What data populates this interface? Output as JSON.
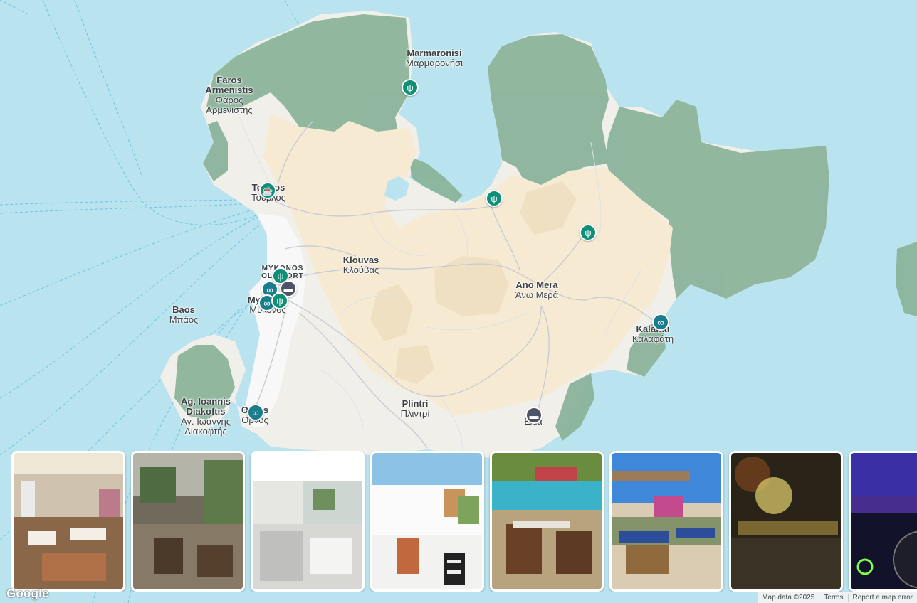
{
  "places": [
    {
      "name": "Marmaronisi",
      "local": "Μαρμαρονήσι"
    },
    {
      "name": "Faros Armenistis",
      "local": "Φάρος Αρμενιστής"
    },
    {
      "name": "Tourlos",
      "local": "Τούρλος"
    },
    {
      "name": "Klouvas",
      "local": "Κλούβας"
    },
    {
      "name": "Ano Mera",
      "local": "Άνω Μερά"
    },
    {
      "name": "MYKONOS OLD PORT",
      "local": ""
    },
    {
      "name": "Mykonos",
      "local": "Μύκονος"
    },
    {
      "name": "Baos",
      "local": "Μπάος"
    },
    {
      "name": "Kalafati",
      "local": "Καλαφάτη"
    },
    {
      "name": "Ag. Ioannis Diakoftis",
      "local": "Αγ. Ιωάννης Διακοφτής"
    },
    {
      "name": "Ornos",
      "local": "Ορνος"
    },
    {
      "name": "Plintri",
      "local": "Πλιντρί"
    },
    {
      "name": "Elia",
      "local": "Ελιά"
    }
  ],
  "pins": [
    {
      "type": "restaurant",
      "icon": "fork-knife-icon",
      "glyph": "ψ"
    },
    {
      "type": "restaurant",
      "icon": "fork-knife-icon",
      "glyph": "ψ"
    },
    {
      "type": "restaurant",
      "icon": "fork-knife-icon",
      "glyph": "ψ"
    },
    {
      "type": "cafe",
      "icon": "coffee-cup-icon",
      "glyph": "☕"
    },
    {
      "type": "restaurant",
      "icon": "fork-knife-icon",
      "glyph": "ψ"
    },
    {
      "type": "attraction",
      "icon": "binoculars-icon",
      "glyph": "∞"
    },
    {
      "type": "hotel",
      "icon": "bed-icon",
      "glyph": "▬"
    },
    {
      "type": "attraction",
      "icon": "binoculars-icon",
      "glyph": "∞"
    },
    {
      "type": "restaurant",
      "icon": "fork-knife-icon",
      "glyph": "ψ"
    },
    {
      "type": "attraction",
      "icon": "binoculars-icon",
      "glyph": "∞"
    },
    {
      "type": "attraction",
      "icon": "binoculars-icon",
      "glyph": "∞"
    },
    {
      "type": "hotel",
      "icon": "bed-icon",
      "glyph": "▬"
    }
  ],
  "photos": [
    {
      "name": "photo-restaurant-interior"
    },
    {
      "name": "photo-garden-courtyard"
    },
    {
      "name": "photo-white-terrace"
    },
    {
      "name": "photo-cycladic-patio"
    },
    {
      "name": "photo-seaside-taverna"
    },
    {
      "name": "photo-pergola-terrace"
    },
    {
      "name": "photo-cocktail-glass"
    },
    {
      "name": "photo-dj-club"
    }
  ],
  "attribution": {
    "logo": "Google",
    "map_data": "Map data ©2025",
    "terms": "Terms",
    "report": "Report a map error"
  },
  "colors": {
    "water": "#b9e3ee",
    "land": "#f1efea",
    "forest": "#8bb49b",
    "sand": "#f6ead3",
    "restaurant_pin": "#0e8f77",
    "attraction_pin": "#197d8c",
    "hotel_pin": "#4e5367"
  }
}
